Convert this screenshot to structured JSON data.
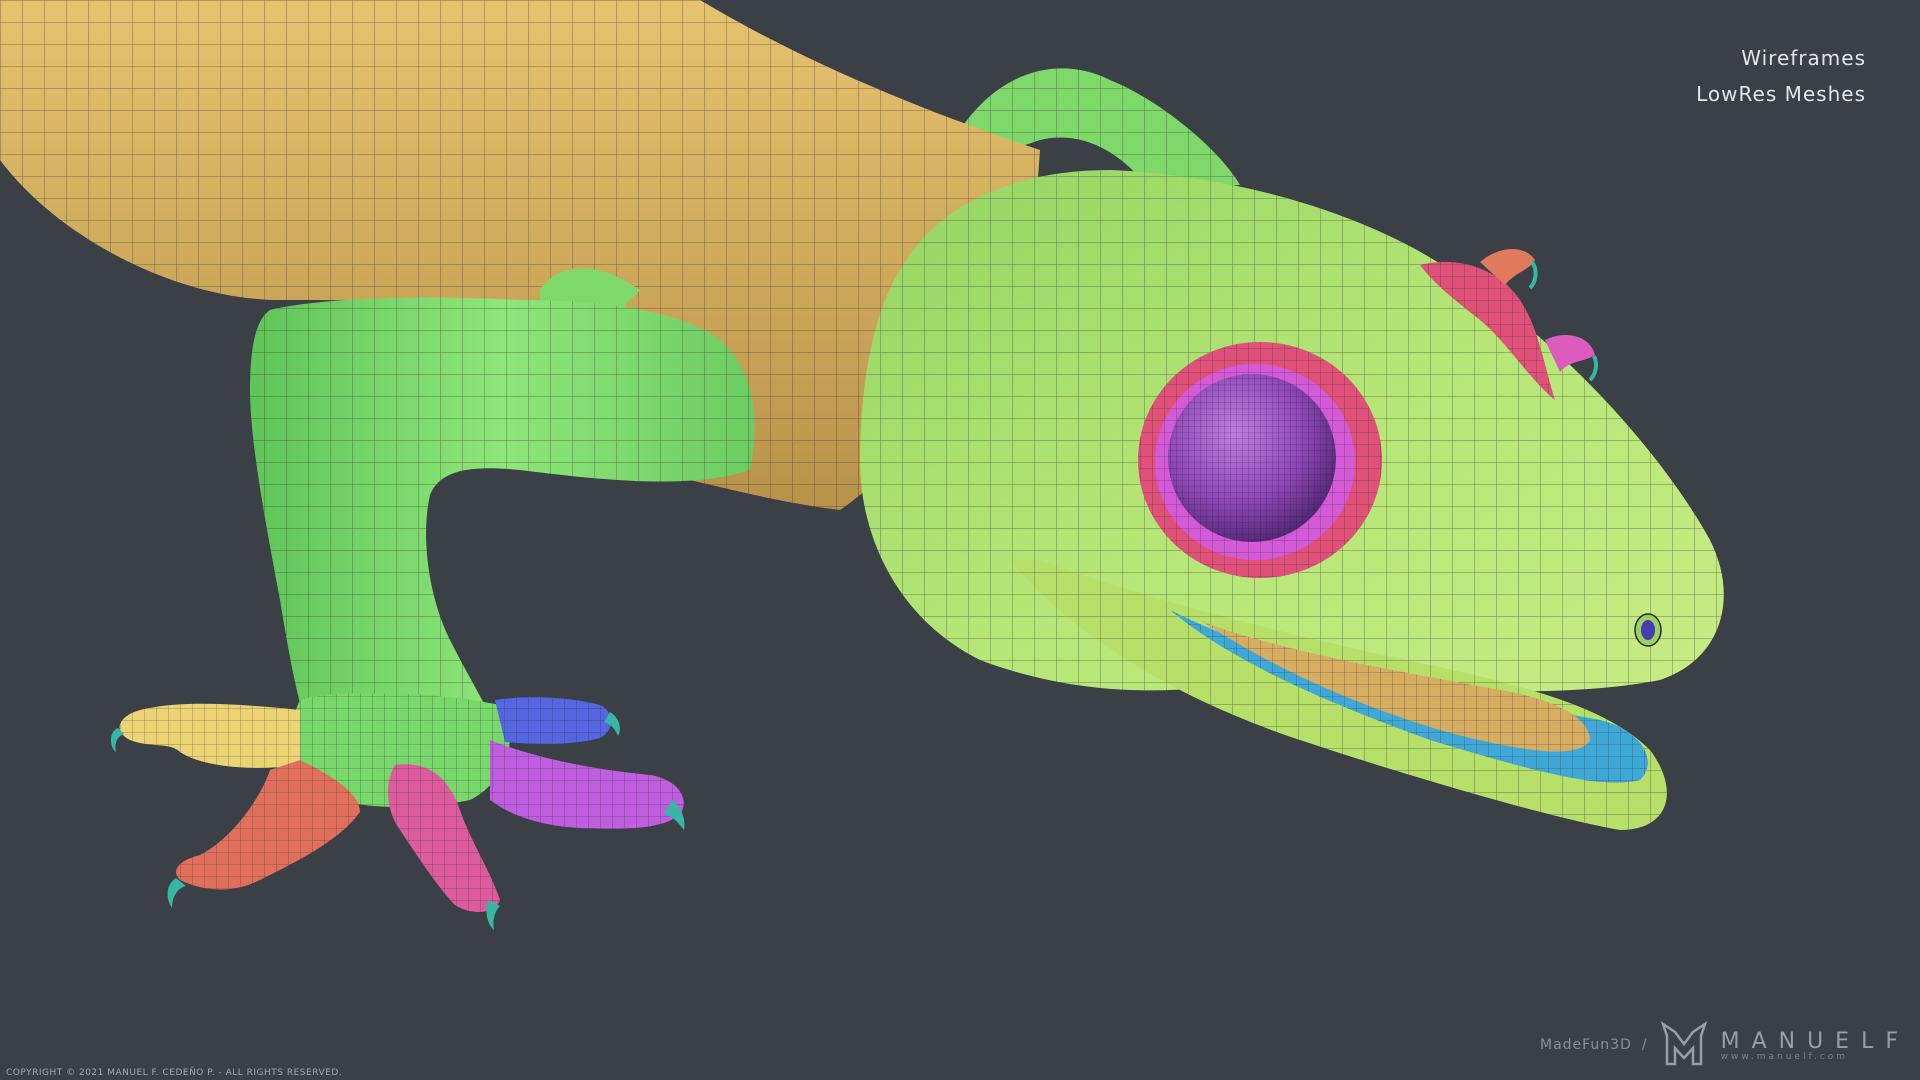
{
  "overlay": {
    "title_line1": "Wireframes",
    "title_line2": "LowRes Meshes"
  },
  "footer": {
    "copyright": "COPYRIGHT © 2021 MANUEL F. CEDEÑO P. - ALL RIGHTS RESERVED.",
    "madefun": "MadeFun3D",
    "slash": "/",
    "brand": "MANUELF",
    "url": "www.manuelf.com"
  },
  "colors": {
    "background": "#3b3f46",
    "body": "#d9b45f",
    "body_green": "#8fe06a",
    "head": "#a9e069",
    "eye_ring": "#e0517a",
    "eye_inner_ring": "#d45ad8",
    "eyeball": "#8c47b4",
    "mouth_blue": "#3fa8d6",
    "tongue": "#d7ad62",
    "toe_yellow": "#ecd474",
    "toe_red": "#e0705c",
    "toe_pink": "#dc5c9e",
    "toe_purple": "#c05ee0",
    "toe_blue": "#5566e0",
    "claw_teal": "#36b7a4"
  }
}
